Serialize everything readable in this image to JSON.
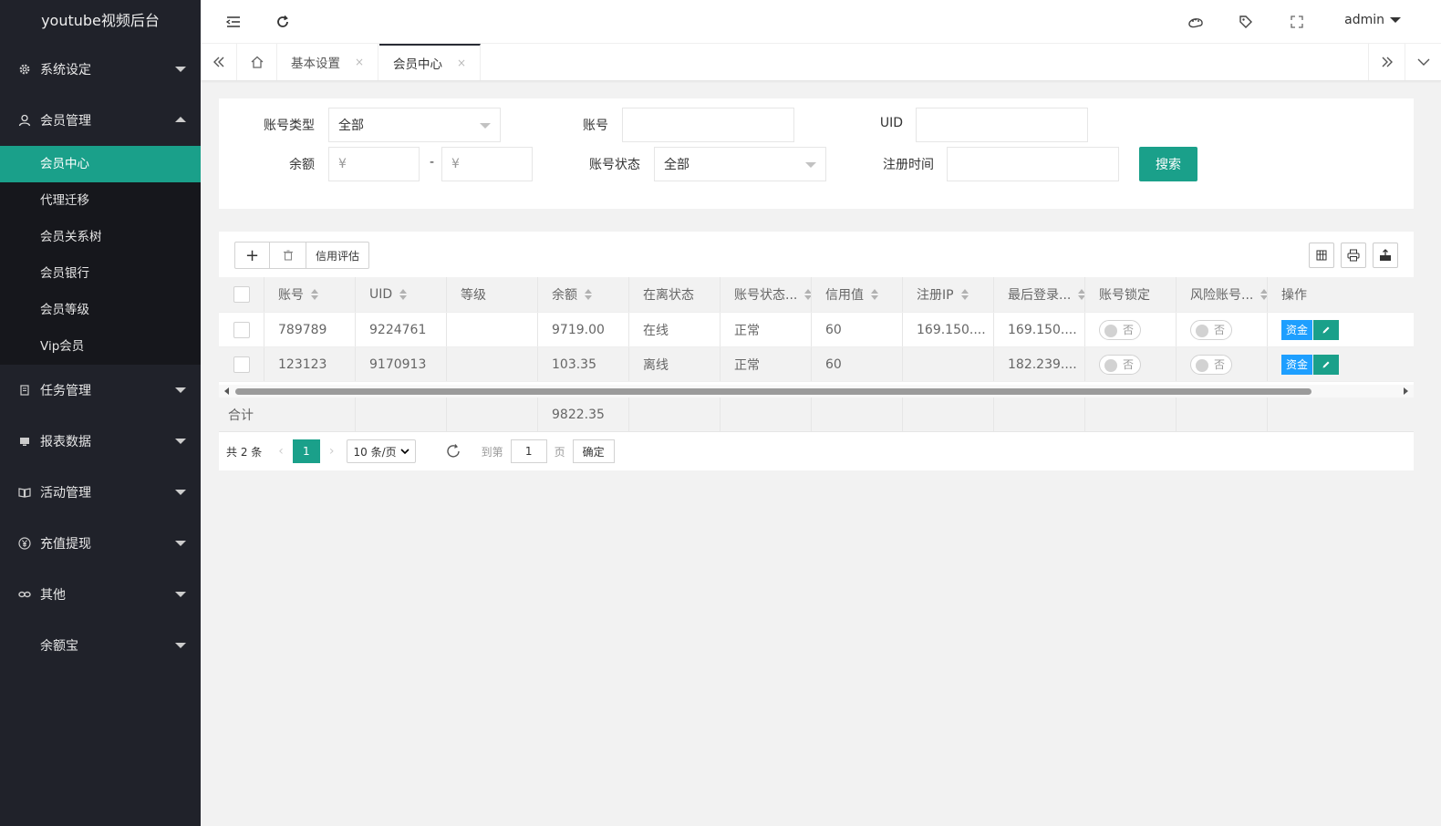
{
  "app": {
    "title": "youtube视频后台"
  },
  "sidebar": {
    "groups": [
      {
        "label": "系统设定",
        "icon": "gear-icon"
      },
      {
        "label": "会员管理",
        "icon": "user-icon",
        "items": [
          "会员中心",
          "代理迁移",
          "会员关系树",
          "会员银行",
          "会员等级",
          "Vip会员"
        ],
        "active": "会员中心"
      },
      {
        "label": "任务管理",
        "icon": "document-icon"
      },
      {
        "label": "报表数据",
        "icon": "monitor-icon"
      },
      {
        "label": "活动管理",
        "icon": "book-icon"
      },
      {
        "label": "充值提现",
        "icon": "yen-icon"
      },
      {
        "label": "其他",
        "icon": "link-icon"
      },
      {
        "label": "余额宝",
        "icon": ""
      }
    ]
  },
  "header": {
    "user": "admin",
    "icons": [
      "menu-fold-icon",
      "refresh-icon",
      "palette-icon",
      "tag-icon",
      "fullscreen-icon"
    ]
  },
  "tabs": {
    "items": [
      "基本设置",
      "会员中心"
    ],
    "active": "会员中心",
    "close": "×"
  },
  "search": {
    "labels": {
      "account_type": "账号类型",
      "account": "账号",
      "uid": "UID",
      "balance": "余额",
      "account_status": "账号状态",
      "register_time": "注册时间"
    },
    "account_type_value": "全部",
    "account_status_value": "全部",
    "balance_min_placeholder": "¥",
    "balance_max_placeholder": "¥",
    "range_sep": "-",
    "button": "搜索"
  },
  "toolbar": {
    "credit": "信用评估",
    "add": "+",
    "icons": [
      "add-icon",
      "trash-icon",
      "columns-icon",
      "print-icon",
      "export-icon"
    ]
  },
  "table": {
    "columns": [
      "账号",
      "UID",
      "等级",
      "余额",
      "在离状态",
      "账号状态...",
      "信用值",
      "注册IP",
      "最后登录...",
      "账号锁定",
      "风险账号...",
      "操作"
    ],
    "rows": [
      {
        "account": "789789",
        "uid": "9224761",
        "level": "",
        "balance": "9719.00",
        "online": "在线",
        "status": "正常",
        "credit": "60",
        "reg_ip": "169.150....",
        "last_login": "169.150....",
        "lock": "否",
        "risk": "否"
      },
      {
        "account": "123123",
        "uid": "9170913",
        "level": "",
        "balance": "103.35",
        "online": "离线",
        "status": "正常",
        "credit": "60",
        "reg_ip": "",
        "last_login": "182.239....",
        "lock": "否",
        "risk": "否"
      }
    ],
    "op_fund": "资金",
    "total_label": "合计",
    "total_balance": "9822.35"
  },
  "pager": {
    "total": "共 2 条",
    "current": "1",
    "page_size": "10 条/页",
    "goto": "到第",
    "goto_value": "1",
    "page_unit": "页",
    "confirm": "确定"
  },
  "colors": {
    "accent": "#1aa08a",
    "sidebar_bg": "#20222a",
    "fund_blue": "#1e9fff"
  }
}
